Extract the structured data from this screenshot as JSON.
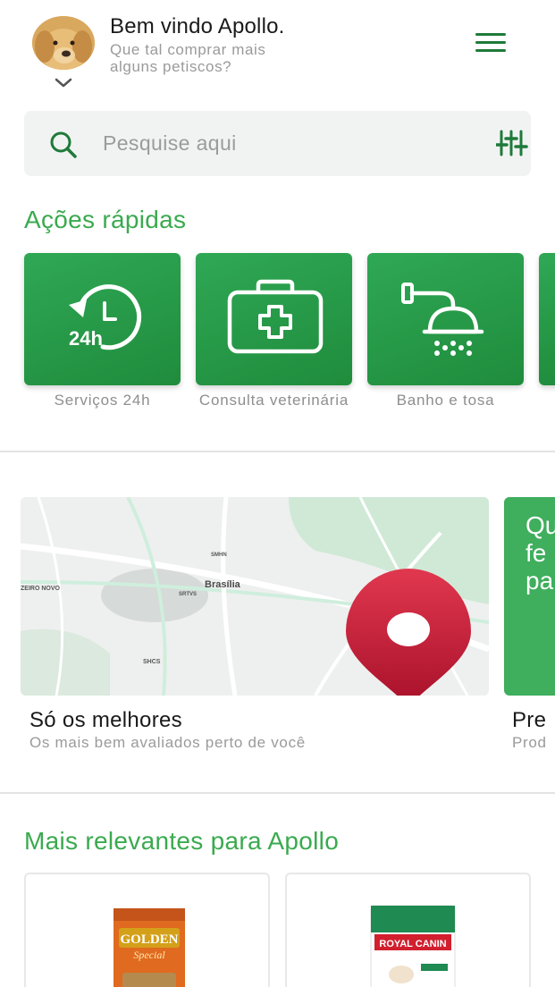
{
  "header": {
    "greeting": "Bem vindo Apollo.",
    "subtitle": "Que tal comprar mais alguns petiscos?",
    "avatar_icon": "dog-avatar",
    "menu_icon": "hamburger-menu-icon"
  },
  "search": {
    "placeholder": "Pesquise aqui",
    "value": ""
  },
  "quick_actions": {
    "title": "Ações rápidas",
    "items": [
      {
        "label": "Serviços 24h",
        "icon": "clock-24h-icon"
      },
      {
        "label": "Consulta veterinária",
        "icon": "first-aid-kit-icon"
      },
      {
        "label": "Banho e tosa",
        "icon": "shower-icon"
      }
    ]
  },
  "banners": {
    "map": {
      "title": "Só os melhores",
      "subtitle": "Os mais bem avaliados perto de você",
      "map_labels": {
        "city": "Brasília",
        "district": "ZEIRO NOVO",
        "shcs": "SHCS",
        "smhn": "SMHN",
        "srtvs": "SRTVS"
      }
    },
    "second": {
      "partial_text": "Qu fe pa",
      "title": "Pre",
      "subtitle": "Prod"
    }
  },
  "relevant": {
    "title": "Mais relevantes para Apollo",
    "products": [
      {
        "brand": "GOLDEN",
        "sub": "Special"
      },
      {
        "brand": "ROYAL CANIN"
      }
    ]
  },
  "colors": {
    "brand_green": "#3aaa4f",
    "dark_green": "#1f8c3c",
    "pin_red": "#c8102e"
  }
}
